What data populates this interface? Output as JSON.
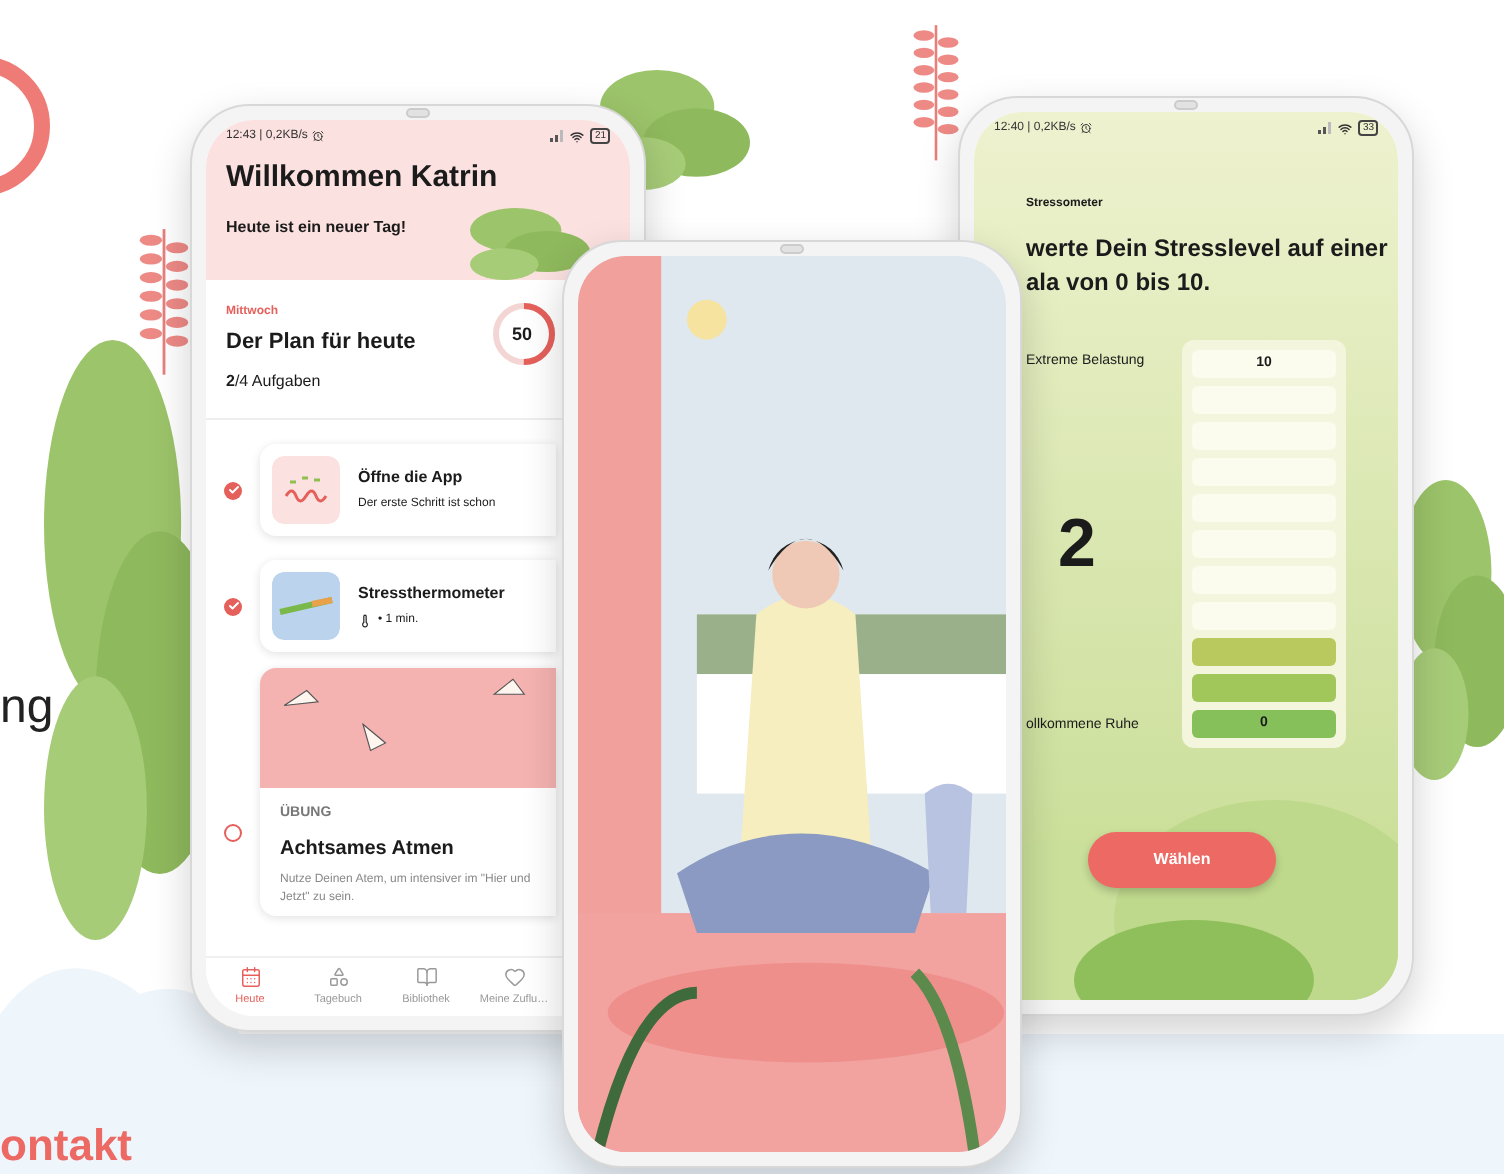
{
  "page": {
    "text_fragment": "ng",
    "heading_fragment": "ontakt"
  },
  "today_screen": {
    "status_time": "12:43 | 0,2KB/s",
    "battery": "21",
    "title": "Willkommen Katrin",
    "subtitle": "Heute ist ein neuer Tag!",
    "day": "Mittwoch",
    "plan_title": "Der Plan für heute",
    "plan_count": "**2**/4 Aufgaben",
    "progress_text": "50",
    "progress": {
      "level": 0.5
    },
    "tasks": [
      {
        "kind": "app",
        "title": "Öffne die App",
        "subtitle": "Der erste Schritt ist schon",
        "checked": true
      },
      {
        "kind": "thermometer",
        "title": "Stressthermometer",
        "subtitle": "•  1 min.",
        "checked": true
      }
    ],
    "exercise": {
      "checked": false,
      "category": "ÜBUNG",
      "title": "Achtsames Atmen",
      "description": "Nutze Deinen Atem, um intensiver im \"Hier und Jetzt\" zu sein."
    },
    "tabs": [
      {
        "kind": "calendar",
        "label": "Heute",
        "selected": true
      },
      {
        "kind": "shapes",
        "label": "Tagebuch",
        "selected": false
      },
      {
        "kind": "book",
        "label": "Bibliothek",
        "selected": false
      },
      {
        "kind": "heart",
        "label": "Meine Zuflu…",
        "selected": false
      }
    ]
  },
  "stressometer_screen": {
    "status_time": "12:40 | 0,2KB/s",
    "battery": "33",
    "overline": "Stressometer",
    "question_lines": [
      "werte Dein Stresslevel auf einer",
      "ala von 0 bis 10."
    ],
    "top_label": "Extreme Belastung",
    "bottom_label": "ollkommene Ruhe",
    "value": "2",
    "scale": [
      {
        "label": "10",
        "filled": false
      },
      {
        "filled": false
      },
      {
        "filled": false
      },
      {
        "filled": false
      },
      {
        "filled": false
      },
      {
        "filled": false
      },
      {
        "filled": false
      },
      {
        "filled": false
      },
      {
        "filled": true,
        "color": "#b9c95e"
      },
      {
        "filled": true,
        "color": "#a1c75a"
      },
      {
        "label": "0",
        "filled": true,
        "color": "#86c05a"
      }
    ],
    "button": "Wählen"
  }
}
